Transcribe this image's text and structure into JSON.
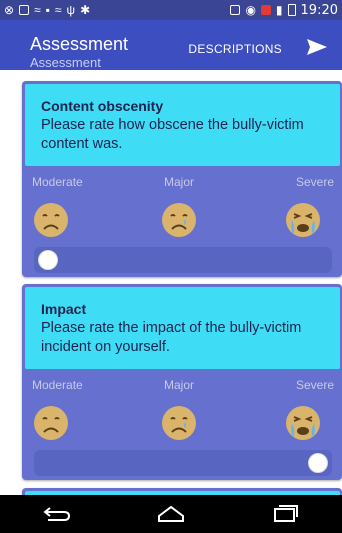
{
  "status_bar": {
    "time": "19:20",
    "icons_left": [
      "sync-icon",
      "image-icon",
      "hotspot-icon",
      "sd-card-icon",
      "wifi-direct-icon",
      "usb-icon",
      "android-debug-icon"
    ],
    "icons_right": [
      "screen-mirror-icon",
      "wifi-icon",
      "notification-icon",
      "signal-icon",
      "battery-icon"
    ]
  },
  "app_bar": {
    "title": "Assessment",
    "subtitle": "Assessment",
    "action_label": "DESCRIPTIONS",
    "send_icon": "send-icon"
  },
  "colors": {
    "status_bar": "#3a4596",
    "app_bar": "#3d4fc0",
    "card": "#6570cf",
    "question_box": "#3fdcf5",
    "slider_track": "#5866c2"
  },
  "questions": [
    {
      "title": "Content obscenity",
      "text": "Please rate how obscene the bully-victim content was.",
      "scale": [
        "Moderate",
        "Major",
        "Severe"
      ],
      "slider_fraction": 0
    },
    {
      "title": "Impact",
      "text": "Please rate the impact of the bully-victim incident on yourself.",
      "scale": [
        "Moderate",
        "Major",
        "Severe"
      ],
      "slider_fraction": 1
    }
  ],
  "nav": {
    "back_icon": "back-icon",
    "home_icon": "home-icon",
    "recents_icon": "recents-icon"
  }
}
